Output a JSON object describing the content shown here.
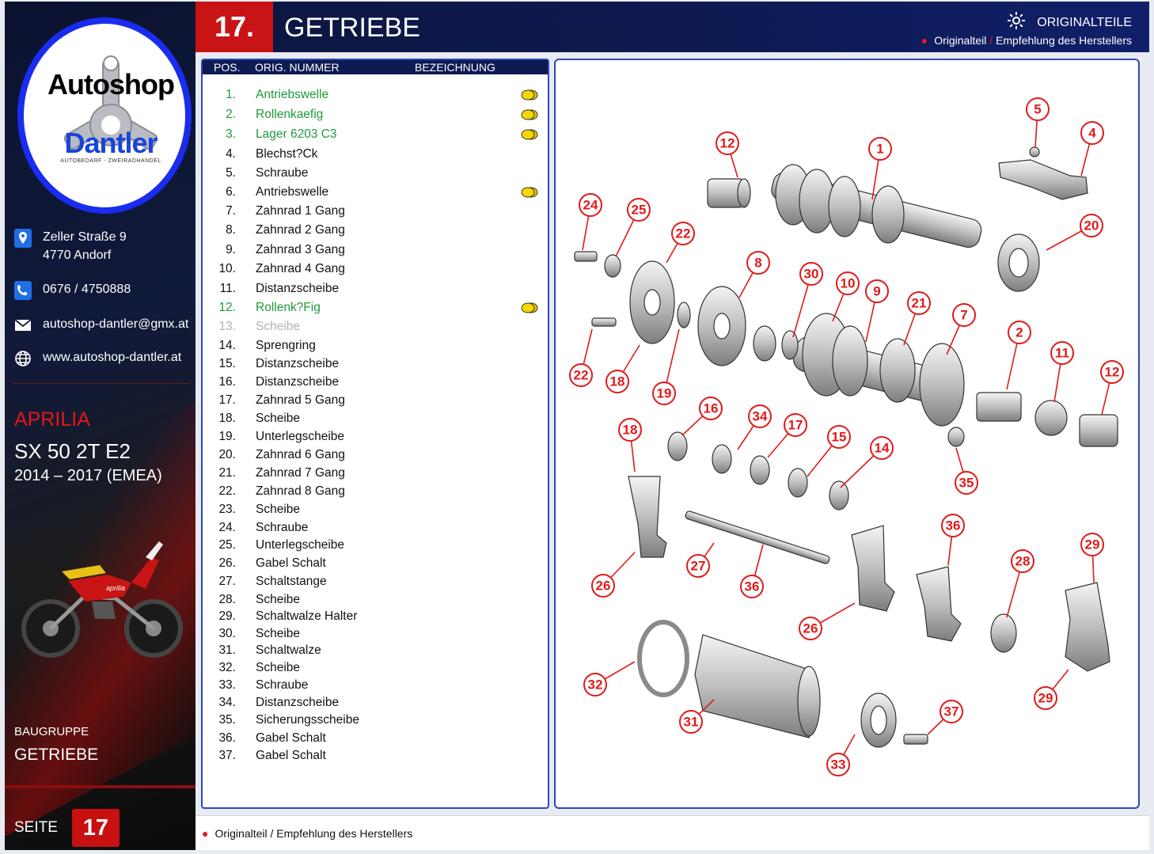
{
  "sidebar": {
    "logo_top": "Autoshop",
    "logo_bottom": "Dantler",
    "logo_sub": "AUTOBEDARF - ZWEIRADHANDEL",
    "address_line1": "Zeller Straße 9",
    "address_line2": "4770 Andorf",
    "phone": "0676 / 4750888",
    "email": "autoshop-dantler@gmx.at",
    "website": "www.autoshop-dantler.at",
    "brand": "APRILIA",
    "model": "SX 50 2T E2",
    "years": "2014 – 2017 (EMEA)",
    "group_label": "BAUGRUPPE",
    "group_value": "GETRIEBE",
    "page_label": "SEITE",
    "page_number": "17"
  },
  "header": {
    "chapter_number": "17.",
    "chapter_title": "GETRIEBE",
    "originalteile_label": "ORIGINALTEILE",
    "legend_part1": "Originalteil",
    "legend_sep": "/",
    "legend_part2": "Empfehlung des Herstellers"
  },
  "table": {
    "col_pos": "POS.",
    "col_orig": "ORIG. NUMMER",
    "col_desc": "BEZEICHNUNG",
    "rows": [
      {
        "pos": "1.",
        "name": "Antriebswelle",
        "style": "green",
        "coin": true
      },
      {
        "pos": "2.",
        "name": "Rollenkaefig",
        "style": "green",
        "coin": true
      },
      {
        "pos": "3.",
        "name": "Lager 6203 C3",
        "style": "green",
        "coin": true
      },
      {
        "pos": "4.",
        "name": "Blechst?Ck",
        "style": "normal",
        "coin": false
      },
      {
        "pos": "5.",
        "name": "Schraube",
        "style": "normal",
        "coin": false
      },
      {
        "pos": "6.",
        "name": "Antriebswelle",
        "style": "normal",
        "coin": true
      },
      {
        "pos": "7.",
        "name": "Zahnrad 1 Gang",
        "style": "normal",
        "coin": false
      },
      {
        "pos": "8.",
        "name": "Zahnrad 2 Gang",
        "style": "normal",
        "coin": false
      },
      {
        "pos": "9.",
        "name": "Zahnrad 3 Gang",
        "style": "normal",
        "coin": false
      },
      {
        "pos": "10.",
        "name": "Zahnrad 4 Gang",
        "style": "normal",
        "coin": false
      },
      {
        "pos": "11.",
        "name": "Distanzscheibe",
        "style": "normal",
        "coin": false
      },
      {
        "pos": "12.",
        "name": "Rollenk?Fig",
        "style": "green",
        "coin": true
      },
      {
        "pos": "13.",
        "name": "Scheibe",
        "style": "grey",
        "coin": false
      },
      {
        "pos": "14.",
        "name": "Sprengring",
        "style": "normal",
        "coin": false
      },
      {
        "pos": "15.",
        "name": "Distanzscheibe",
        "style": "normal",
        "coin": false
      },
      {
        "pos": "16.",
        "name": "Distanzscheibe",
        "style": "normal",
        "coin": false
      },
      {
        "pos": "17.",
        "name": "Zahnrad 5 Gang",
        "style": "normal",
        "coin": false
      },
      {
        "pos": "18.",
        "name": "Scheibe",
        "style": "normal",
        "coin": false
      },
      {
        "pos": "19.",
        "name": "Unterlegscheibe",
        "style": "normal",
        "coin": false
      },
      {
        "pos": "20.",
        "name": "Zahnrad 6 Gang",
        "style": "normal",
        "coin": false
      },
      {
        "pos": "21.",
        "name": "Zahnrad 7 Gang",
        "style": "normal",
        "coin": false
      },
      {
        "pos": "22.",
        "name": "Zahnrad 8 Gang",
        "style": "normal",
        "coin": false
      },
      {
        "pos": "23.",
        "name": "Scheibe",
        "style": "normal",
        "coin": false
      },
      {
        "pos": "24.",
        "name": "Schraube",
        "style": "normal",
        "coin": false
      },
      {
        "pos": "25.",
        "name": "Unterlegscheibe",
        "style": "normal",
        "coin": false
      },
      {
        "pos": "26.",
        "name": "Gabel Schalt",
        "style": "normal",
        "coin": false
      },
      {
        "pos": "27.",
        "name": "Schaltstange",
        "style": "normal",
        "coin": false
      },
      {
        "pos": "28.",
        "name": "Scheibe",
        "style": "normal",
        "coin": false
      },
      {
        "pos": "29.",
        "name": "Schaltwalze Halter",
        "style": "normal",
        "coin": false
      },
      {
        "pos": "30.",
        "name": "Scheibe",
        "style": "normal",
        "coin": false
      },
      {
        "pos": "31.",
        "name": "Schaltwalze",
        "style": "normal",
        "coin": false
      },
      {
        "pos": "32.",
        "name": "Scheibe",
        "style": "normal",
        "coin": false
      },
      {
        "pos": "33.",
        "name": "Schraube",
        "style": "normal",
        "coin": false
      },
      {
        "pos": "34.",
        "name": "Distanzscheibe",
        "style": "normal",
        "coin": false
      },
      {
        "pos": "35.",
        "name": "Sicherungsscheibe",
        "style": "normal",
        "coin": false
      },
      {
        "pos": "36.",
        "name": "Gabel Schalt",
        "style": "normal",
        "coin": false
      },
      {
        "pos": "37.",
        "name": "Gabel Schalt",
        "style": "normal",
        "coin": false
      }
    ]
  },
  "diagram": {
    "callouts": [
      "1",
      "2",
      "4",
      "5",
      "7",
      "8",
      "9",
      "10",
      "11",
      "12",
      "12",
      "14",
      "15",
      "16",
      "17",
      "18",
      "18",
      "19",
      "20",
      "21",
      "22",
      "22",
      "24",
      "25",
      "26",
      "26",
      "27",
      "28",
      "29",
      "29",
      "30",
      "31",
      "32",
      "33",
      "34",
      "35",
      "36",
      "36",
      "37"
    ]
  },
  "footer": {
    "note_part1": "Originalteil",
    "note_sep": "/",
    "note_part2": "Empfehlung des Herstellers"
  },
  "colors": {
    "accent_red": "#c81414",
    "navy": "#0e1a52",
    "green_original": "#1e9a3a",
    "callout_red": "#e01a1a"
  }
}
